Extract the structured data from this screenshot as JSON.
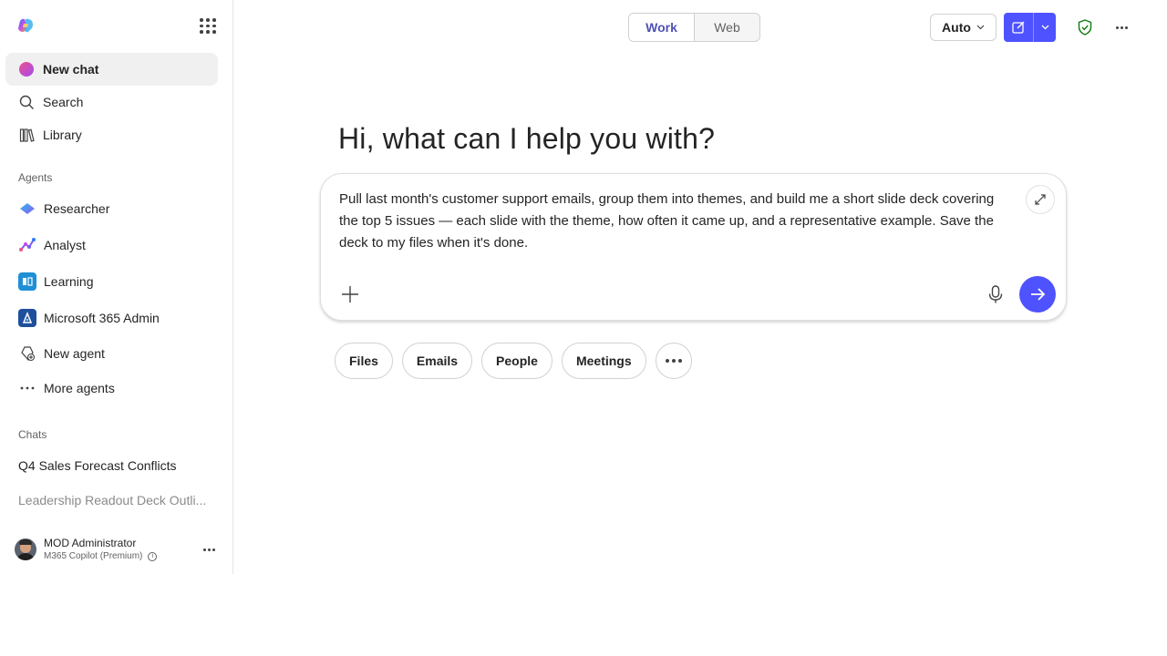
{
  "sidebar": {
    "nav": [
      {
        "label": "New chat",
        "icon": "copilot-chat-icon"
      },
      {
        "label": "Search",
        "icon": "search-icon"
      },
      {
        "label": "Library",
        "icon": "library-icon"
      }
    ],
    "agents_label": "Agents",
    "agents": [
      {
        "label": "Researcher",
        "icon": "researcher-icon"
      },
      {
        "label": "Analyst",
        "icon": "analyst-icon"
      },
      {
        "label": "Learning",
        "icon": "learning-icon"
      },
      {
        "label": "Microsoft 365 Admin",
        "icon": "m365-admin-icon"
      },
      {
        "label": "New agent",
        "icon": "new-agent-icon"
      },
      {
        "label": "More agents",
        "icon": "more-icon"
      }
    ],
    "chats_label": "Chats",
    "chats": [
      {
        "label": "Q4 Sales Forecast Conflicts"
      },
      {
        "label": "Leadership Readout Deck Outli..."
      }
    ],
    "profile": {
      "name": "MOD Administrator",
      "plan": "M365 Copilot (Premium)"
    }
  },
  "topbar": {
    "mode_tabs": [
      {
        "label": "Work",
        "active": true
      },
      {
        "label": "Web",
        "active": false
      }
    ],
    "model_select": "Auto"
  },
  "main": {
    "greeting": "Hi, what can I help you with?",
    "prompt": "Pull last month's customer support emails, group them into themes, and build me a short slide deck covering the top 5 issues — each slide with the theme, how often it came up, and a representative example. Save the deck to my files when it's done.",
    "chips": [
      "Files",
      "Emails",
      "People",
      "Meetings"
    ]
  },
  "colors": {
    "accent": "#4f52ff",
    "active_tab_text": "#4f52b2"
  }
}
